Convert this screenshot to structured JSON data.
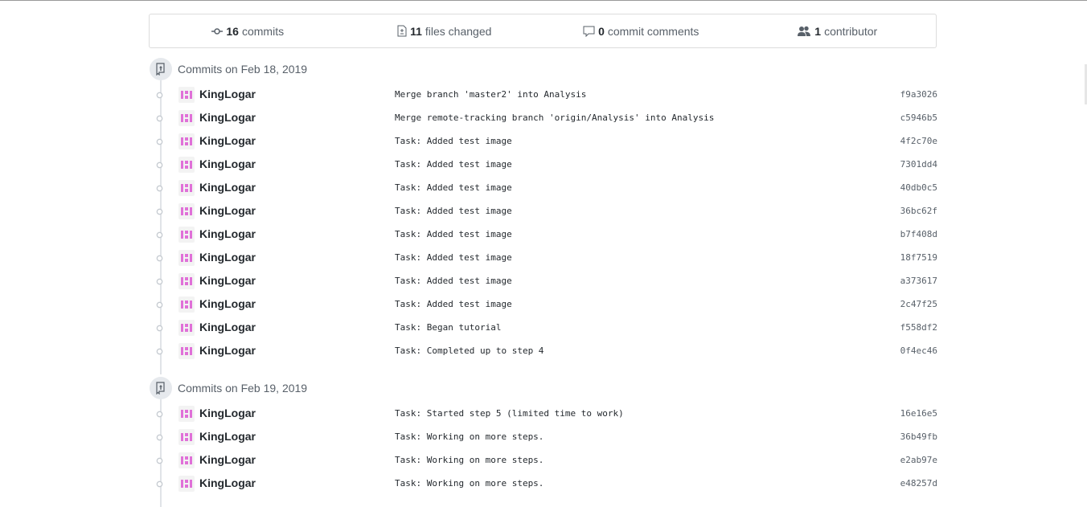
{
  "summary": {
    "commits_count": "16",
    "commits_label": "commits",
    "files_count": "11",
    "files_label": "files changed",
    "comments_count": "0",
    "comments_label": "commit comments",
    "contributors_count": "1",
    "contributors_label": "contributor"
  },
  "groups": [
    {
      "title": "Commits on Feb 18, 2019",
      "commits": [
        {
          "author": "KingLogar",
          "message": "Merge branch 'master2' into Analysis",
          "sha": "f9a3026"
        },
        {
          "author": "KingLogar",
          "message": "Merge remote-tracking branch 'origin/Analysis' into Analysis",
          "sha": "c5946b5"
        },
        {
          "author": "KingLogar",
          "message": "Task: Added test image",
          "sha": "4f2c70e"
        },
        {
          "author": "KingLogar",
          "message": "Task: Added test image",
          "sha": "7301dd4"
        },
        {
          "author": "KingLogar",
          "message": "Task: Added test image",
          "sha": "40db0c5"
        },
        {
          "author": "KingLogar",
          "message": "Task: Added test image",
          "sha": "36bc62f"
        },
        {
          "author": "KingLogar",
          "message": "Task: Added test image",
          "sha": "b7f408d"
        },
        {
          "author": "KingLogar",
          "message": "Task: Added test image",
          "sha": "18f7519"
        },
        {
          "author": "KingLogar",
          "message": "Task: Added test image",
          "sha": "a373617"
        },
        {
          "author": "KingLogar",
          "message": "Task: Added test image",
          "sha": "2c47f25"
        },
        {
          "author": "KingLogar",
          "message": "Task: Began tutorial",
          "sha": "f558df2"
        },
        {
          "author": "KingLogar",
          "message": "Task: Completed up to step 4",
          "sha": "0f4ec46"
        }
      ]
    },
    {
      "title": "Commits on Feb 19, 2019",
      "commits": [
        {
          "author": "KingLogar",
          "message": "Task: Started step 5 (limited time to work)",
          "sha": "16e16e5"
        },
        {
          "author": "KingLogar",
          "message": "Task: Working on more steps.",
          "sha": "36b49fb"
        },
        {
          "author": "KingLogar",
          "message": "Task: Working on more steps.",
          "sha": "e2ab97e"
        },
        {
          "author": "KingLogar",
          "message": "Task: Working on more steps.",
          "sha": "e48257d"
        }
      ]
    }
  ],
  "colors": {
    "avatar_accent": "#e070d8",
    "link": "#24292e",
    "muted": "#586069"
  },
  "icons": {
    "commits": "git-commit-icon",
    "files": "file-diff-icon",
    "comments": "comment-icon",
    "contributors": "people-icon",
    "group": "repo-push-icon"
  }
}
